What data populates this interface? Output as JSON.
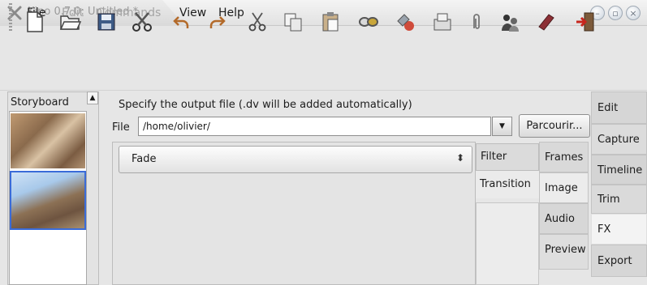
{
  "window": {
    "title": "Kino 0.7.0: Untitled *",
    "controls": [
      "minimize",
      "maximize",
      "close"
    ]
  },
  "menu": {
    "items": [
      {
        "label": "File",
        "enabled": true
      },
      {
        "label": "Edit",
        "enabled": false
      },
      {
        "label": "Commands",
        "enabled": false
      },
      {
        "label": "View",
        "enabled": true
      },
      {
        "label": "Help",
        "enabled": true
      }
    ]
  },
  "toolbar": {
    "icons": [
      "new-file-icon",
      "open-folder-icon",
      "save-icon",
      "cut-scissors-icon",
      "undo-icon",
      "redo-icon",
      "cut-icon",
      "copy-icon",
      "paste-icon",
      "link-icon",
      "mix-icon",
      "scene-icon",
      "clip-icon",
      "people-icon",
      "book-icon",
      "exit-icon"
    ]
  },
  "storyboard": {
    "label": "Storyboard"
  },
  "export": {
    "instructions": "Specify the output file (.dv will be added automatically)",
    "file_label": "File",
    "file_value": "/home/olivier/",
    "browse_label": "Parcourir..."
  },
  "fx": {
    "effect_selected": "Fade",
    "subtabs": [
      "Filter",
      "Transition"
    ],
    "middle_tabs": [
      "Frames",
      "Image",
      "Audio",
      "Preview"
    ]
  },
  "main_tabs": {
    "items": [
      "Edit",
      "Capture",
      "Timeline",
      "Trim",
      "FX",
      "Export"
    ],
    "active": "FX"
  },
  "colors": {
    "selection_border": "#3a6bd8",
    "disabled_text": "#a5a5a5",
    "save_icon": "#3d5b86",
    "exit_icon": "#c7261d"
  }
}
